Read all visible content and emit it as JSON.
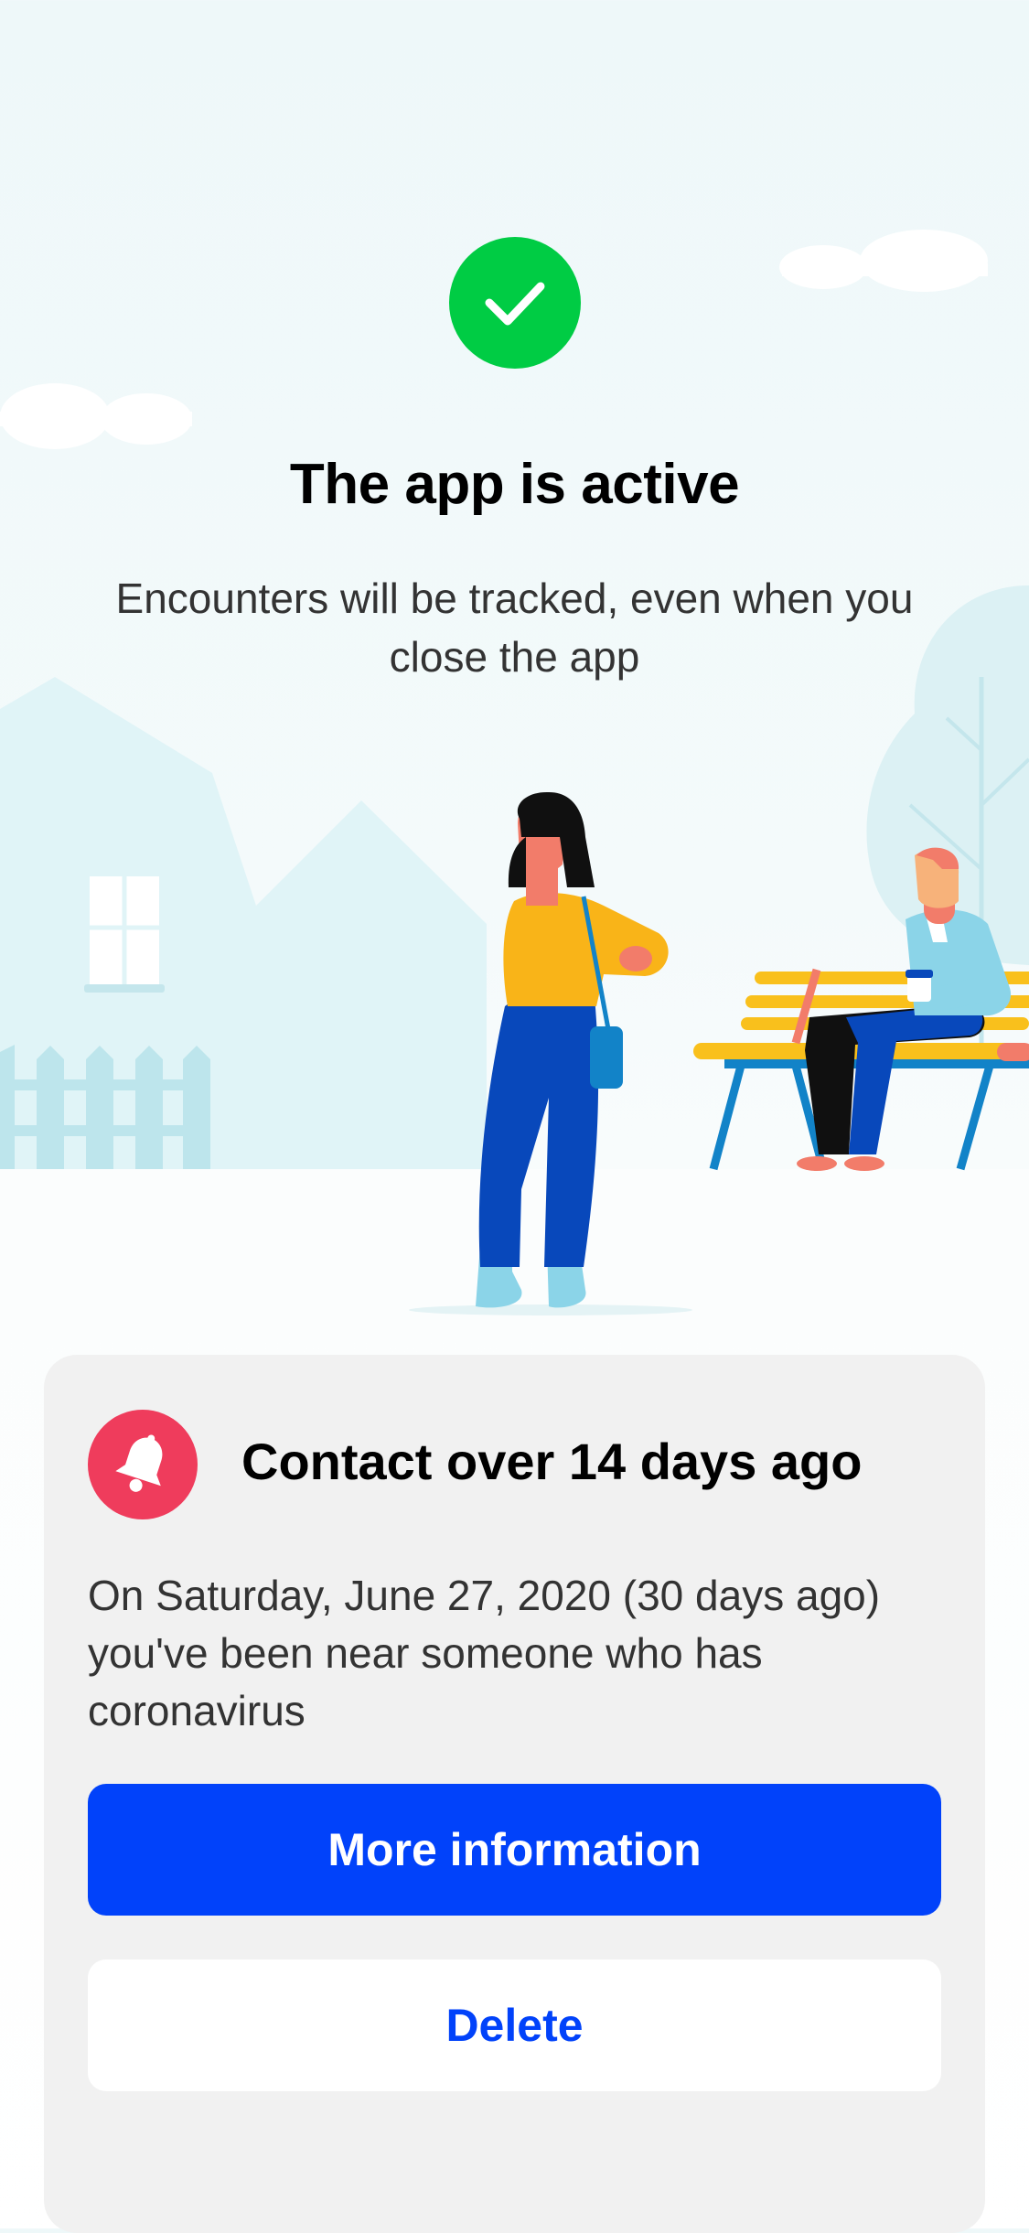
{
  "colors": {
    "success": "#00cc44",
    "alert": "#ef3c5c",
    "primary": "#0142fa",
    "card_background": "#f1f1f1"
  },
  "icons": {
    "status": "checkmark-icon",
    "alert": "bell-icon"
  },
  "status": {
    "title": "The app is active",
    "subtitle": "Encounters will be tracked, even when you close the app"
  },
  "notification": {
    "title": "Contact over 14 days ago",
    "body": "On Saturday, June 27, 2020 (30 days ago) you've been near someone who has coronavirus",
    "more_info_label": "More information",
    "delete_label": "Delete"
  }
}
